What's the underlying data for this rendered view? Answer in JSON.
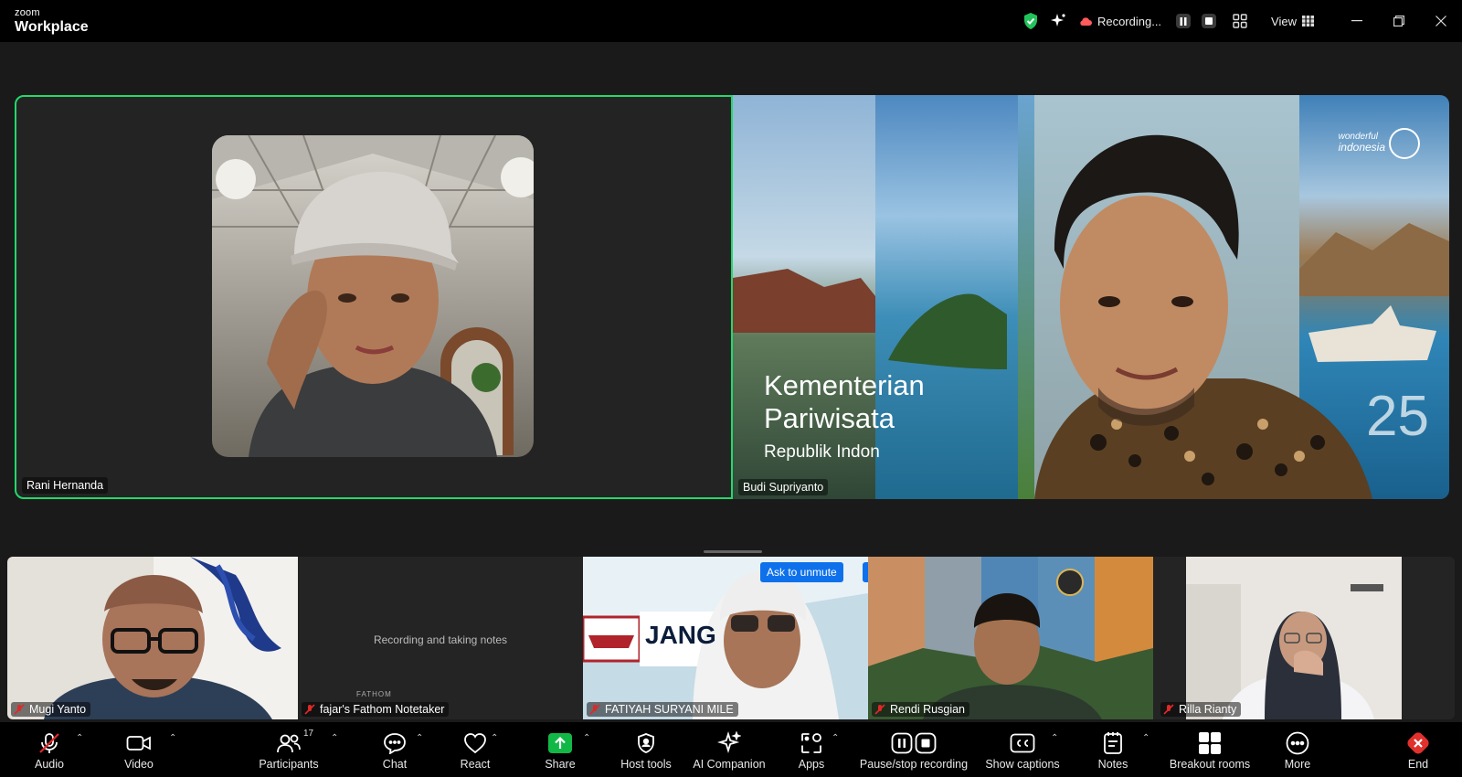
{
  "app": {
    "brand_small": "zoom",
    "brand_big": "Workplace"
  },
  "titlebar": {
    "recording_label": "Recording...",
    "view_label": "View"
  },
  "main_tiles": {
    "left_name": "Rani Hernanda",
    "right_name": "Budi Supriyanto",
    "slide": {
      "line1": "Kementerian",
      "line2": "Pariwisata",
      "line3": "Republik Indon",
      "logo_line1": "wonderful",
      "logo_line2": "indonesia",
      "corner_digits": "25"
    }
  },
  "gallery": [
    {
      "name": "Mugi Yanto",
      "muted": true
    },
    {
      "name": "fajar's Fathom Notetaker",
      "muted": true,
      "overlay_text": "Recording and taking notes",
      "footer_text": "FATHOM"
    },
    {
      "name": "FATIYAH SURYANI MILE",
      "muted": true,
      "ask_unmute": "Ask to unmute",
      "more": "···",
      "banner": "JANG"
    },
    {
      "name": "Rendi Rusgian",
      "muted": true
    },
    {
      "name": "Rilla Rianty",
      "muted": true
    }
  ],
  "toolbar": {
    "audio": "Audio",
    "video": "Video",
    "participants": "Participants",
    "participants_count": "17",
    "chat": "Chat",
    "react": "React",
    "share": "Share",
    "host_tools": "Host tools",
    "ai_companion": "AI Companion",
    "apps": "Apps",
    "pause_stop": "Pause/stop recording",
    "captions": "Show captions",
    "notes": "Notes",
    "breakout": "Breakout rooms",
    "more": "More",
    "end": "End"
  },
  "colors": {
    "active_speaker": "#23d96a",
    "share_green": "#12b846",
    "end_red": "#e0312c",
    "ask_blue": "#0e71eb"
  }
}
